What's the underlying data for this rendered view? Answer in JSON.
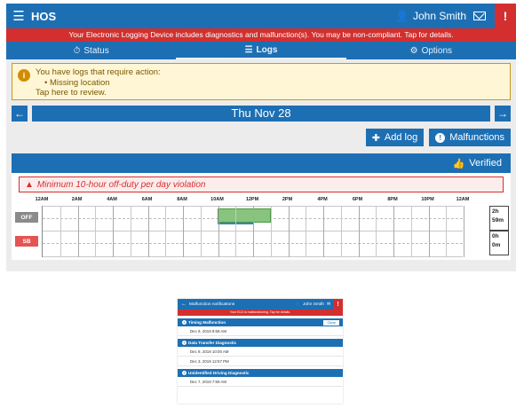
{
  "main": {
    "app_title": "HOS",
    "user_name": "John Smith",
    "banner": "Your Electronic Logging Device includes diagnostics and malfunction(s). You may be non-compliant. Tap for details.",
    "tabs": [
      {
        "label": "Status",
        "icon": "clock-icon"
      },
      {
        "label": "Logs",
        "icon": "list-icon"
      },
      {
        "label": "Options",
        "icon": "gears-icon"
      }
    ],
    "warning": {
      "line1": "You have logs that require action:",
      "bullet": "Missing location",
      "line3": "Tap here to review."
    },
    "date": "Thu Nov 28",
    "add_log_label": "Add log",
    "malfunctions_label": "Malfunctions",
    "verified_label": "Verified",
    "violation": "Minimum 10-hour off-duty per day violation",
    "hour_labels": [
      "12AM",
      "2AM",
      "4AM",
      "6AM",
      "8AM",
      "10AM",
      "12PM",
      "2PM",
      "4PM",
      "6PM",
      "8PM",
      "10PM",
      "12AM"
    ],
    "rows": [
      {
        "label": "OFF",
        "total_h": "2h",
        "total_m": "59m"
      },
      {
        "label": "SB",
        "total_h": "0h",
        "total_m": "0m"
      }
    ]
  },
  "inset": {
    "title": "Malfunction notifications",
    "user_name": "John Smith",
    "banner": "Your ELD is malfunctioning. Tap for details.",
    "sections": [
      {
        "title": "Timing Malfunction",
        "clear_label": "Clear",
        "items": [
          "Dec 9, 2019 9:59 AM"
        ]
      },
      {
        "title": "Data Transfer Diagnostic",
        "items": [
          "Dec 9, 2019 10:00 AM",
          "Dec 3, 2019 12:57 PM"
        ]
      },
      {
        "title": "Unidentified Driving Diagnostic",
        "items": [
          "Dec 7, 2019 7:59 AM"
        ]
      }
    ]
  },
  "colors": {
    "primary": "#1d6fb4",
    "danger": "#d32f2f",
    "warning_bg": "#fff6d6",
    "off_duty_block": "#88c47e"
  }
}
